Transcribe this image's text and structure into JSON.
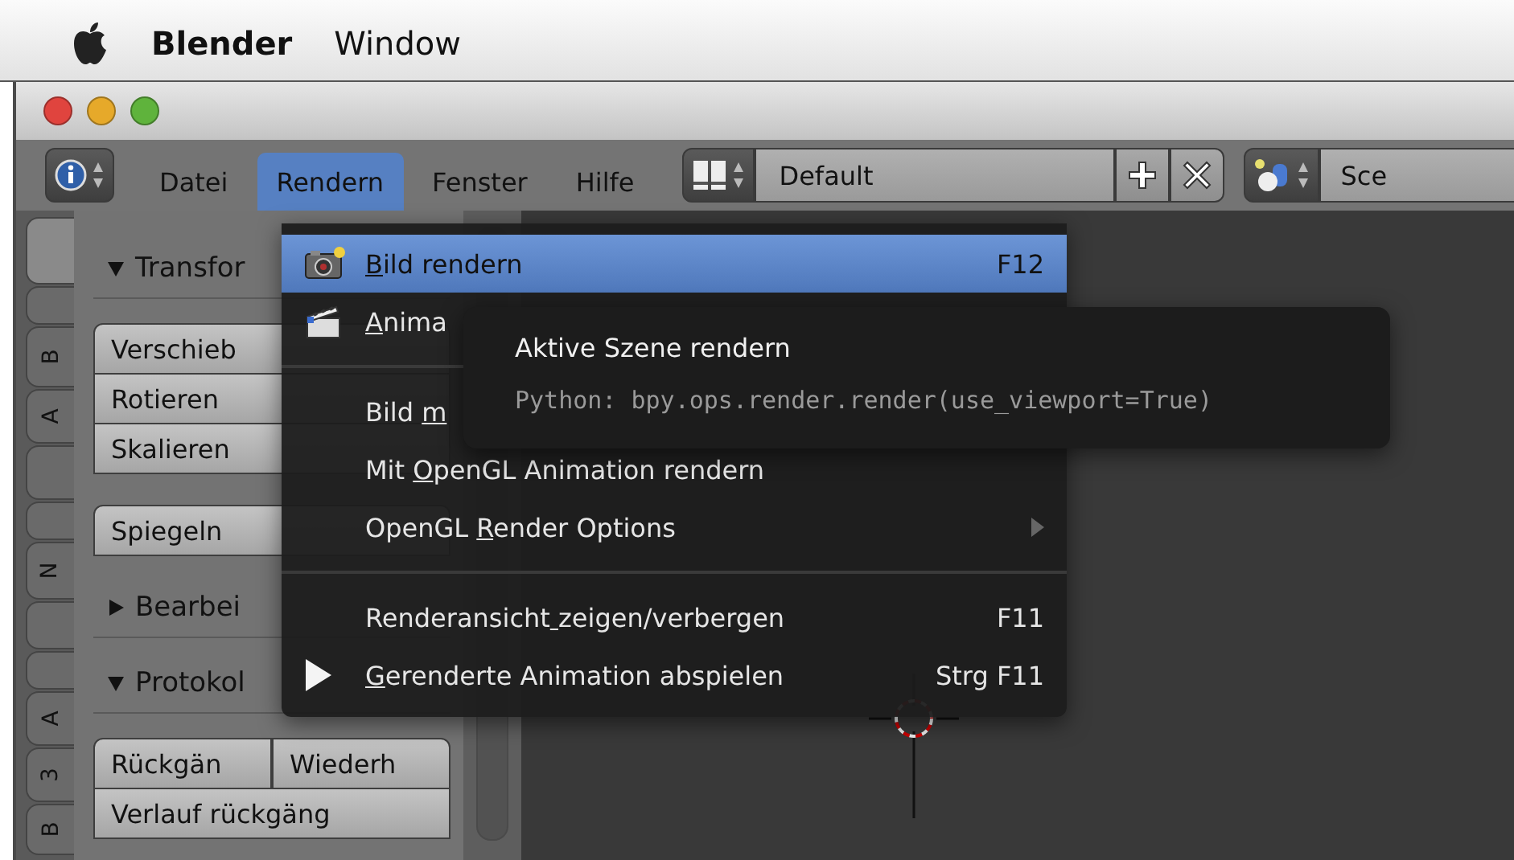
{
  "menubar": {
    "app": "Blender",
    "items": [
      "Window"
    ]
  },
  "window": {
    "lights": [
      {
        "color": "#e0443e"
      },
      {
        "color": "#e6a92a"
      },
      {
        "color": "#5fb33c"
      }
    ]
  },
  "header": {
    "menus": [
      {
        "label": "Datei",
        "selected": false
      },
      {
        "label": "Rendern",
        "selected": true
      },
      {
        "label": "Fenster",
        "selected": false
      },
      {
        "label": "Hilfe",
        "selected": false
      }
    ],
    "layout": {
      "value": "Default"
    },
    "scene": {
      "value": "Sce"
    }
  },
  "tabs": [
    {
      "selected": true
    },
    {
      "selected": false
    },
    {
      "label": "B",
      "selected": false
    },
    {
      "label": "A",
      "selected": false
    },
    {
      "selected": false
    },
    {
      "selected": false
    },
    {
      "label": "N",
      "selected": false
    },
    {
      "selected": false
    },
    {
      "selected": false
    },
    {
      "label": "A",
      "selected": false
    },
    {
      "label": "3",
      "selected": false
    },
    {
      "label": "B",
      "selected": false
    }
  ],
  "toolshelf": {
    "panels": [
      {
        "title": "Transfor",
        "expanded": true,
        "groups": [
          [
            "Verschieb",
            "Rotieren",
            "Skalieren"
          ],
          [
            "Spiegeln"
          ]
        ]
      },
      {
        "title": "Bearbei",
        "expanded": false
      },
      {
        "title": "Protokol",
        "expanded": true,
        "rows": [
          [
            "Rückgän",
            "Wiederh"
          ],
          [
            "Verlauf rückgäng"
          ]
        ]
      }
    ]
  },
  "menu": {
    "items": [
      {
        "kind": "item",
        "label": "Bild rendern",
        "shortcut": "F12",
        "selected": true
      },
      {
        "kind": "item",
        "label": "Anima",
        "selected": false
      },
      {
        "kind": "separator"
      },
      {
        "kind": "item",
        "label": "Bild m",
        "selected": false
      },
      {
        "kind": "item",
        "label": "Mit OpenGL Animation rendern",
        "selected": false
      },
      {
        "kind": "item",
        "label": "OpenGL Render Options",
        "submenu": true,
        "selected": false
      },
      {
        "kind": "separator"
      },
      {
        "kind": "item",
        "label": "Renderansicht zeigen/verbergen",
        "shortcut": "F11",
        "selected": false
      },
      {
        "kind": "item",
        "label": "Gerenderte Animation abspielen",
        "shortcut": "Strg F11",
        "selected": false
      }
    ]
  },
  "tooltip": {
    "title": "Aktive Szene rendern",
    "python": "Python: bpy.ops.render.render(use_viewport=True)"
  }
}
